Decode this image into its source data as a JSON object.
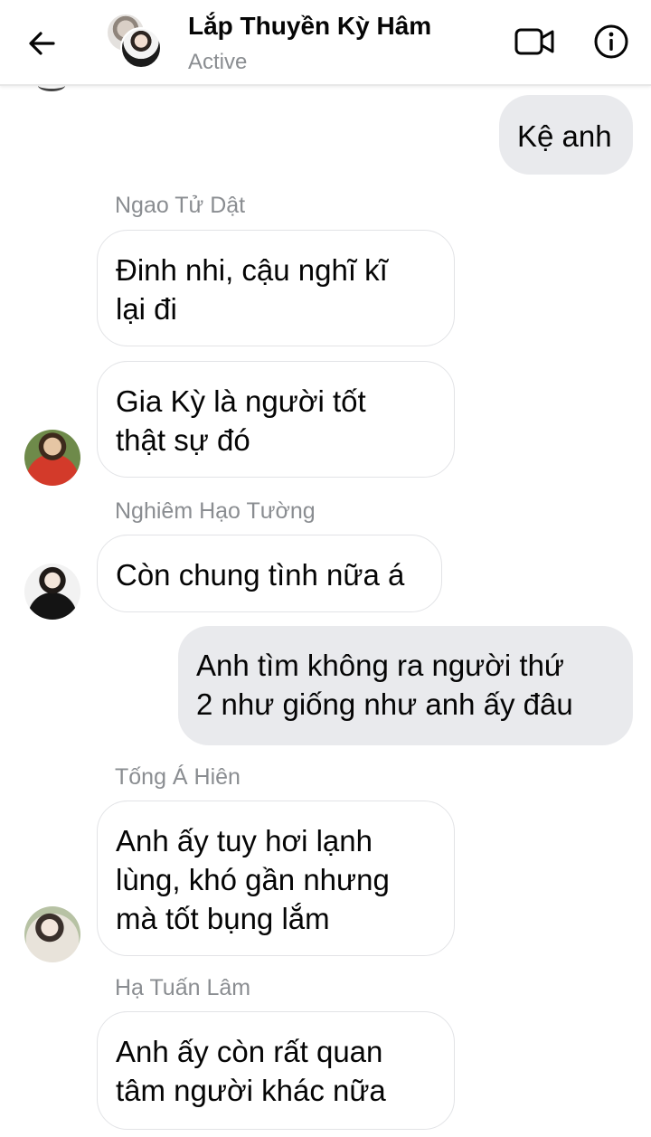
{
  "header": {
    "contact_name": "Lắp Thuyền Kỳ Hâm",
    "status": "Active",
    "back_icon": "back-arrow-icon",
    "video_icon": "video-call-icon",
    "info_icon": "info-icon"
  },
  "colors": {
    "incoming_bubble_bg": "#ffffff",
    "incoming_bubble_border": "#e2e3e6",
    "outgoing_bubble_bg": "#e9eaed",
    "text": "#050505",
    "secondary_text": "#8a8d91"
  },
  "messages": [
    {
      "id": "m1",
      "direction": "outgoing",
      "text": "Kệ anh"
    },
    {
      "id": "m2",
      "direction": "incoming",
      "sender": "Ngao Tử Dật",
      "lines": [
        "Đinh nhi, cậu nghĩ kĩ",
        "lại đi"
      ]
    },
    {
      "id": "m3",
      "direction": "incoming",
      "lines": [
        "Gia Kỳ là người tốt",
        "thật sự đó"
      ]
    },
    {
      "id": "m4",
      "direction": "incoming",
      "sender": "Nghiêm Hạo Tường",
      "lines": [
        "Còn chung tình nữa á"
      ]
    },
    {
      "id": "m5",
      "direction": "outgoing",
      "lines": [
        "Anh tìm không ra người thứ",
        "2 như giống như anh ấy đâu"
      ]
    },
    {
      "id": "m6",
      "direction": "incoming",
      "sender": "Tống Á Hiên",
      "lines": [
        "Anh ấy tuy hơi lạnh",
        "lùng, khó gần nhưng",
        "mà tốt bụng lắm"
      ]
    },
    {
      "id": "m7",
      "direction": "incoming",
      "sender": "Hạ Tuấn Lâm",
      "lines": [
        "Anh ấy còn rất quan",
        "tâm người khác nữa"
      ]
    }
  ]
}
